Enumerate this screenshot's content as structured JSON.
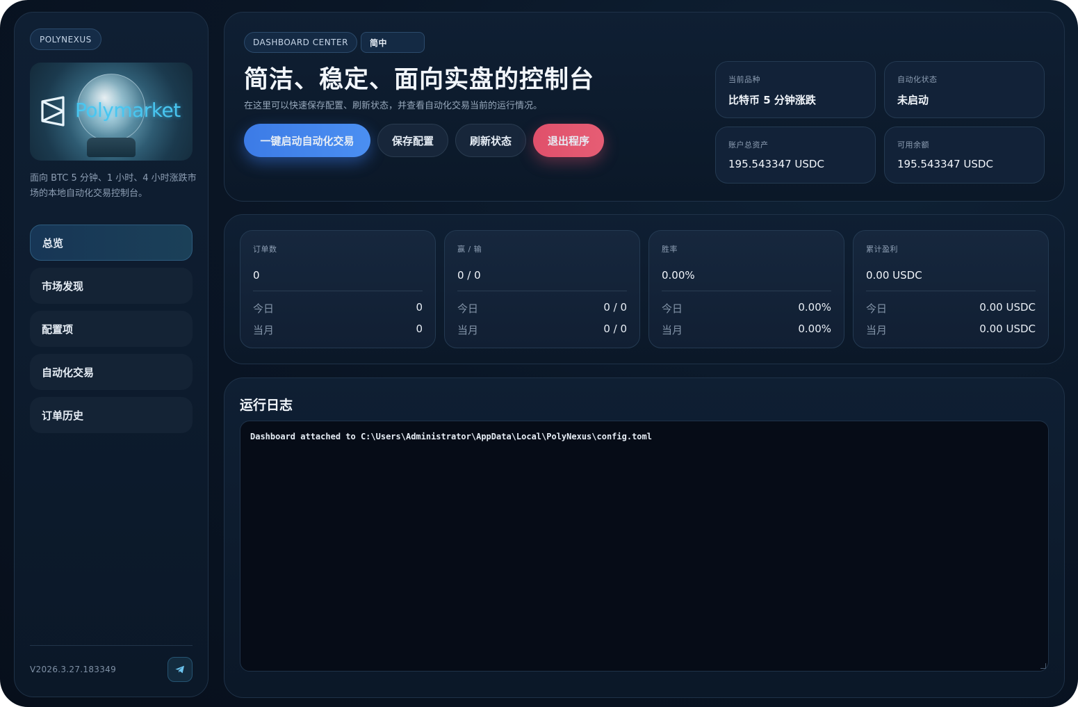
{
  "sidebar": {
    "brand": "POLYNEXUS",
    "logo_text": "Polymarket",
    "description": "面向 BTC 5 分钟、1 小时、4 小时涨跌市场的本地自动化交易控制台。",
    "nav": [
      {
        "label": "总览",
        "active": true
      },
      {
        "label": "市场发现",
        "active": false
      },
      {
        "label": "配置项",
        "active": false
      },
      {
        "label": "自动化交易",
        "active": false
      },
      {
        "label": "订单历史",
        "active": false
      }
    ],
    "version": "V2026.3.27.183349",
    "telegram_icon": "telegram-icon"
  },
  "hero": {
    "badge": "DASHBOARD CENTER",
    "language": "简中",
    "title": "简洁、稳定、面向实盘的控制台",
    "subtitle": "在这里可以快速保存配置、刷新状态，并查看自动化交易当前的运行情况。",
    "buttons": {
      "start": "一键启动自动化交易",
      "save": "保存配置",
      "refresh": "刷新状态",
      "exit": "退出程序"
    },
    "stats": [
      {
        "label": "当前品种",
        "value": "比特币 5 分钟涨跌"
      },
      {
        "label": "自动化状态",
        "value": "未启动"
      },
      {
        "label": "账户总资产",
        "value": "195.543347 USDC"
      },
      {
        "label": "可用余额",
        "value": "195.543347 USDC"
      }
    ]
  },
  "metrics": [
    {
      "label": "订单数",
      "main": "0",
      "today_label": "今日",
      "today": "0",
      "month_label": "当月",
      "month": "0"
    },
    {
      "label": "赢 / 输",
      "main": "0 / 0",
      "today_label": "今日",
      "today": "0 / 0",
      "month_label": "当月",
      "month": "0 / 0"
    },
    {
      "label": "胜率",
      "main": "0.00%",
      "today_label": "今日",
      "today": "0.00%",
      "month_label": "当月",
      "month": "0.00%"
    },
    {
      "label": "累计盈利",
      "main": "0.00 USDC",
      "today_label": "今日",
      "today": "0.00 USDC",
      "month_label": "当月",
      "month": "0.00 USDC"
    }
  ],
  "logs": {
    "title": "运行日志",
    "content": "Dashboard attached to C:\\Users\\Administrator\\AppData\\Local\\PolyNexus\\config.toml"
  },
  "colors": {
    "accent": "#4b8ff2",
    "danger": "#e65d74",
    "background": "#0a1626"
  }
}
